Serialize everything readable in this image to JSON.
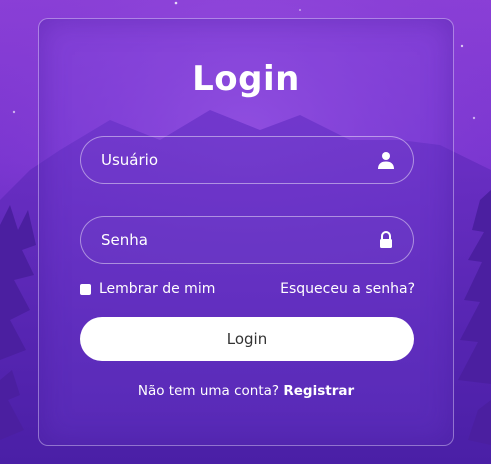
{
  "title": "Login",
  "username": {
    "placeholder": "Usuário",
    "icon": "user-icon"
  },
  "password": {
    "placeholder": "Senha",
    "icon": "lock-icon"
  },
  "remember": {
    "label": "Lembrar de mim",
    "checked": false
  },
  "forgot": {
    "label": "Esqueceu a senha?"
  },
  "login_button": {
    "label": "Login"
  },
  "register": {
    "prompt": "Não tem uma conta?",
    "link": "Registrar"
  },
  "colors": {
    "background_top": "#8a3fd6",
    "background_bottom": "#4a1fa6",
    "button_bg": "#ffffff",
    "text": "#ffffff"
  }
}
